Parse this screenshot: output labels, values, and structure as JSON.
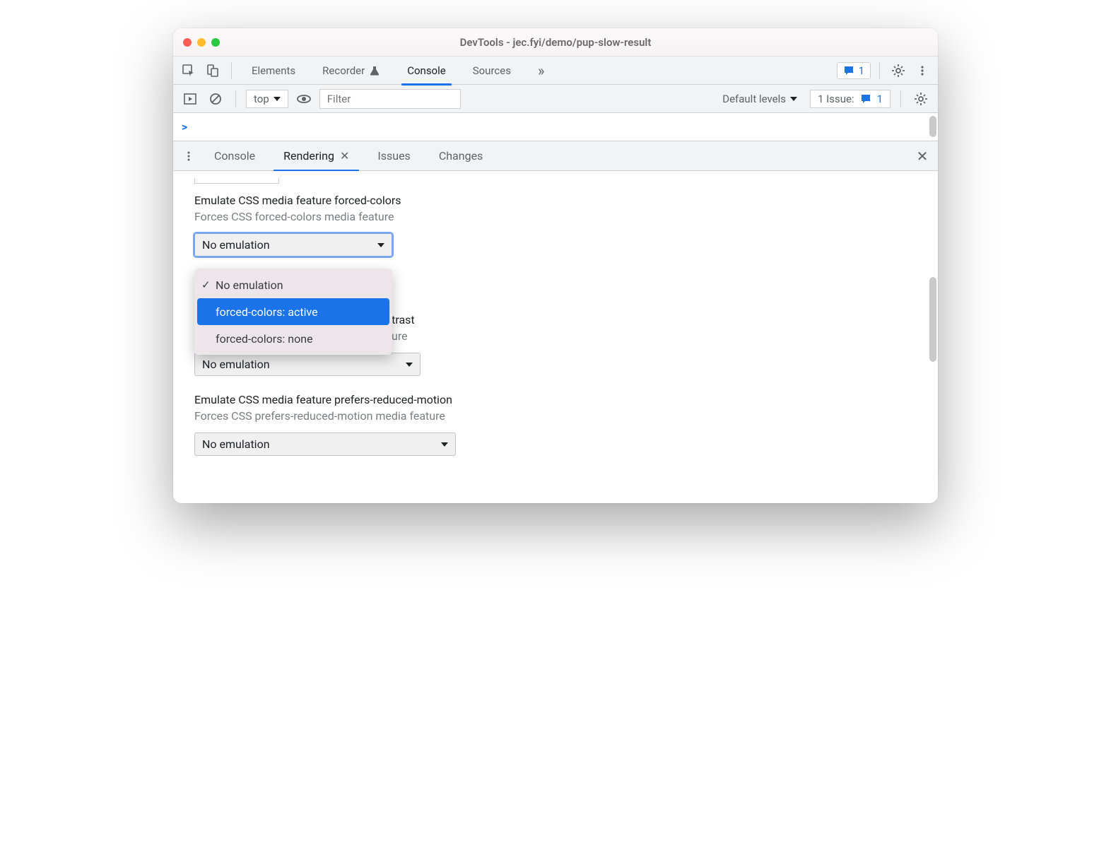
{
  "window": {
    "title": "DevTools - jec.fyi/demo/pup-slow-result"
  },
  "tabs": {
    "items": [
      "Elements",
      "Recorder",
      "Console",
      "Sources"
    ],
    "active": "Console",
    "overflow_glyph": "»",
    "issues_count": "1"
  },
  "toolbar": {
    "context": "top",
    "filter_placeholder": "Filter",
    "levels_label": "Default levels",
    "issue_label": "1 Issue:",
    "issue_count": "1"
  },
  "console": {
    "prompt": ">"
  },
  "drawer": {
    "tabs": [
      "Console",
      "Rendering",
      "Issues",
      "Changes"
    ],
    "active": "Rendering"
  },
  "rendering": {
    "sections": [
      {
        "title": "Emulate CSS media feature forced-colors",
        "desc": "Forces CSS forced-colors media feature",
        "value": "No emulation",
        "options": [
          "No emulation",
          "forced-colors: active",
          "forced-colors: none"
        ],
        "selected": "No emulation",
        "highlighted": "forced-colors: active",
        "open": true
      },
      {
        "title": "Emulate CSS media feature prefers-contrast",
        "desc": "Forces CSS prefers-contrast media feature",
        "value": "No emulation"
      },
      {
        "title": "Emulate CSS media feature prefers-reduced-motion",
        "desc": "Forces CSS prefers-reduced-motion media feature",
        "value": "No emulation"
      }
    ]
  }
}
